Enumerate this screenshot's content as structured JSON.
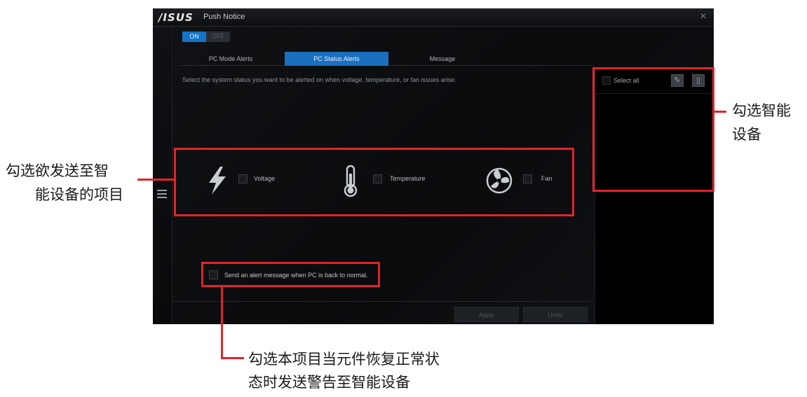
{
  "app": {
    "logo": "/ISUS",
    "title": "Push Notice",
    "close_glyph": "×"
  },
  "toggle": {
    "on_label": "ON",
    "off_label": "OFF"
  },
  "tabs": [
    {
      "label": "PC Mode Alerts",
      "active": false
    },
    {
      "label": "PC Status Alerts",
      "active": true
    },
    {
      "label": "Message",
      "active": false
    }
  ],
  "description": "Select the system status you want to be alerted on when voltage, temperature, or fan issues arise.",
  "alert_items": [
    {
      "label": "Voltage",
      "icon": "lightning-icon"
    },
    {
      "label": "Temperature",
      "icon": "thermometer-icon"
    },
    {
      "label": "Fan",
      "icon": "fan-icon"
    }
  ],
  "send_normal_label": "Send an alert message when PC is back to normal.",
  "buttons": {
    "apply": "Apply",
    "undo": "Undo"
  },
  "device_panel": {
    "select_all": "Select all",
    "edit_icon": "edit-icon",
    "delete_icon": "delete-icon"
  },
  "annotations": {
    "left_line1": "勾选欲发送至智",
    "left_line2": "能设备的项目",
    "right_line1": "勾选智能",
    "right_line2": "设备",
    "bottom_line1": "勾选本项目当元件恢复正常状",
    "bottom_line2": "态时发送警告至智能设备"
  },
  "colors": {
    "accent": "#1a6fbf",
    "annotation": "#e0242a",
    "window_bg": "#0b0c0e"
  }
}
